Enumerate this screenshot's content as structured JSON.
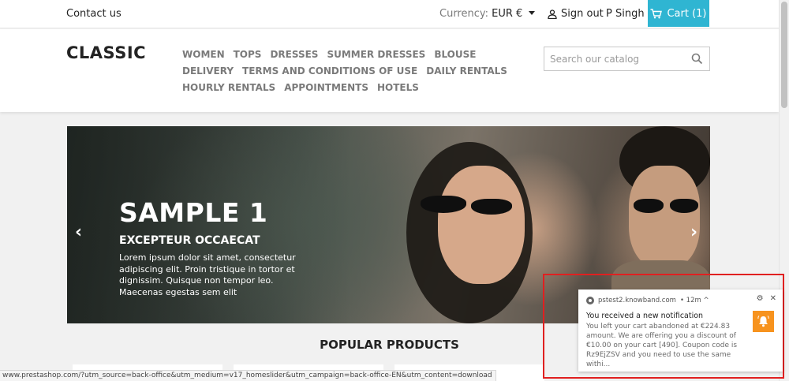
{
  "topbar": {
    "contact": "Contact us",
    "currency_label": "Currency:",
    "currency_value": "EUR €",
    "signout": "Sign out",
    "user": "P Singh",
    "cart": "Cart (1)"
  },
  "header": {
    "logo": "CLASSIC",
    "nav": [
      "WOMEN",
      "TOPS",
      "DRESSES",
      "SUMMER DRESSES",
      "BLOUSE",
      "DELIVERY",
      "TERMS AND CONDITIONS OF USE",
      "DAILY RENTALS",
      "HOURLY RENTALS",
      "APPOINTMENTS",
      "HOTELS"
    ],
    "search_placeholder": "Search our catalog"
  },
  "slider": {
    "title": "SAMPLE 1",
    "subtitle": "EXCEPTEUR OCCAECAT",
    "text": "Lorem ipsum dolor sit amet, consectetur adipiscing elit. Proin tristique in tortor et dignissim. Quisque non tempor leo. Maecenas egestas sem elit"
  },
  "section": {
    "popular": "POPULAR PRODUCTS"
  },
  "statusbar": {
    "url": "www.prestashop.com/?utm_source=back-office&utm_medium=v17_homeslider&utm_campaign=back-office-EN&utm_content=download"
  },
  "notification": {
    "site": "pstest2.knowband.com",
    "time": "• 12m ^",
    "title": "You received a new notification",
    "body": "You left your cart abandoned at €224.83 amount. We are offering you a discount of €10.00 on your cart [490]. Coupon code is Rz9EjZSV and you need to use the same withi..."
  },
  "colors": {
    "cart_bg": "#2fb5d2",
    "highlight_border": "#e02020",
    "bell_bg": "#f7931e"
  }
}
